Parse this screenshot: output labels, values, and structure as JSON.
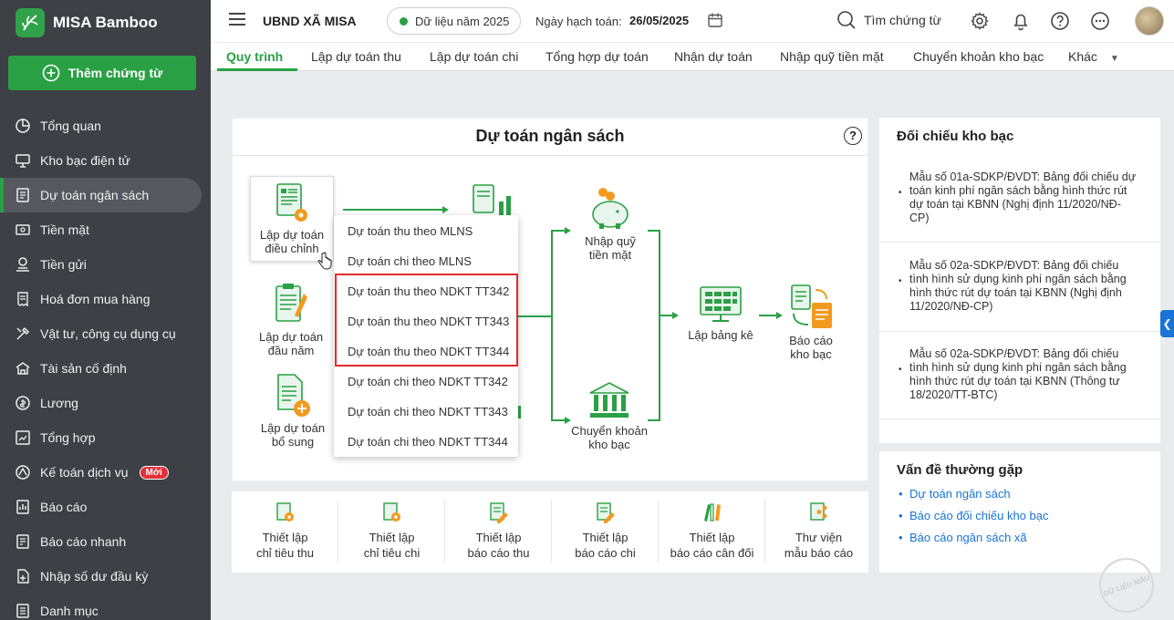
{
  "app": {
    "name": "MISA Bamboo"
  },
  "sidebar": {
    "add_button": "Thêm chứng từ",
    "items": [
      {
        "label": "Tổng quan",
        "icon": "pie-chart-icon"
      },
      {
        "label": "Kho bạc điện tử",
        "icon": "monitor-icon"
      },
      {
        "label": "Dự toán ngân sách",
        "icon": "budget-icon",
        "active": true
      },
      {
        "label": "Tiền mặt",
        "icon": "cash-icon"
      },
      {
        "label": "Tiền gửi",
        "icon": "deposit-icon"
      },
      {
        "label": "Hoá đơn mua hàng",
        "icon": "invoice-icon"
      },
      {
        "label": "Vật tư, công cụ dụng cụ",
        "icon": "tools-icon"
      },
      {
        "label": "Tài sản cố định",
        "icon": "building-icon"
      },
      {
        "label": "Lương",
        "icon": "salary-icon"
      },
      {
        "label": "Tổng hợp",
        "icon": "summary-icon"
      },
      {
        "label": "Kế toán dịch vụ",
        "icon": "service-icon",
        "badge": "Mới"
      },
      {
        "label": "Báo cáo",
        "icon": "report-icon"
      },
      {
        "label": "Báo cáo nhanh",
        "icon": "quick-report-icon"
      },
      {
        "label": "Nhập số dư đầu kỳ",
        "icon": "opening-balance-icon"
      },
      {
        "label": "Danh mục",
        "icon": "catalog-icon"
      }
    ]
  },
  "header": {
    "org": "UBND XÃ MISA",
    "year": "Dữ liệu năm 2025",
    "posting_label": "Ngày hạch toán:",
    "posting_date": "26/05/2025",
    "search": "Tìm chứng từ"
  },
  "tabs": [
    "Quy trình",
    "Lập dự toán thu",
    "Lập dự toán chi",
    "Tổng hợp dự toán",
    "Nhận dự toán",
    "Nhập quỹ tiền mặt",
    "Chuyển khoản kho bạc",
    "Khác"
  ],
  "main": {
    "title": "Dự toán ngân sách",
    "nodes": {
      "adjust": [
        "Lập dự toán",
        "điều chỉnh"
      ],
      "start": [
        "Lập dự toán",
        "đầu năm"
      ],
      "extra": [
        "Lập dự toán",
        "bổ sung"
      ],
      "cash": [
        "Nhập quỹ",
        "tiền mặt"
      ],
      "transfer": [
        "Chuyển khoản",
        "kho bạc"
      ],
      "sheet": [
        "Lập bảng kê"
      ],
      "treasury_report": [
        "Báo cáo",
        "kho bạc"
      ]
    },
    "dropdown": [
      "Dự toán thu theo MLNS",
      "Dự toán chi theo MLNS",
      "Dự toán thu theo NDKT TT342",
      "Dự toán thu theo NDKT TT343",
      "Dự toán thu theo NDKT TT344",
      "Dự toán chi theo NDKT TT342",
      "Dự toán chi theo NDKT TT343",
      "Dự toán chi theo NDKT TT344"
    ]
  },
  "setup": [
    [
      "Thiết lập",
      "chỉ tiêu thu"
    ],
    [
      "Thiết lập",
      "chỉ tiêu chi"
    ],
    [
      "Thiết lập",
      "báo cáo thu"
    ],
    [
      "Thiết lập",
      "báo cáo chi"
    ],
    [
      "Thiết lập",
      "báo cáo cân đối"
    ],
    [
      "Thư viện",
      "mẫu báo cáo"
    ]
  ],
  "reconcile": {
    "title": "Đối chiếu kho bạc",
    "items": [
      "Mẫu số 01a-SDKP/ĐVDT: Bảng đối chiếu dự toán kinh phí ngân sách bằng hình thức rút dự toán tại KBNN (Nghị định 11/2020/NĐ-CP)",
      "Mẫu số 02a-SDKP/ĐVDT: Bảng đối chiếu tình hình sử dụng kinh phí ngân sách bằng hình thức rút dự toán tại KBNN (Nghị định 11/2020/NĐ-CP)",
      "Mẫu số 02a-SDKP/ĐVDT: Bảng đối chiếu tình hình sử dụng kinh phí ngân sách bằng hình thức rút dự toán tại KBNN (Thông tư 18/2020/TT-BTC)"
    ]
  },
  "faq": {
    "title": "Vấn đề thường gặp",
    "links": [
      "Dự toán ngân sách",
      "Báo cáo đối chiếu kho bạc",
      "Báo cáo ngân sách xã"
    ]
  },
  "watermark": "DỮ LIỆU MẪU",
  "colors": {
    "accent": "#2aa044",
    "sidebar": "#3d4045",
    "link": "#1a73d6",
    "highlight": "#e02b2b"
  }
}
